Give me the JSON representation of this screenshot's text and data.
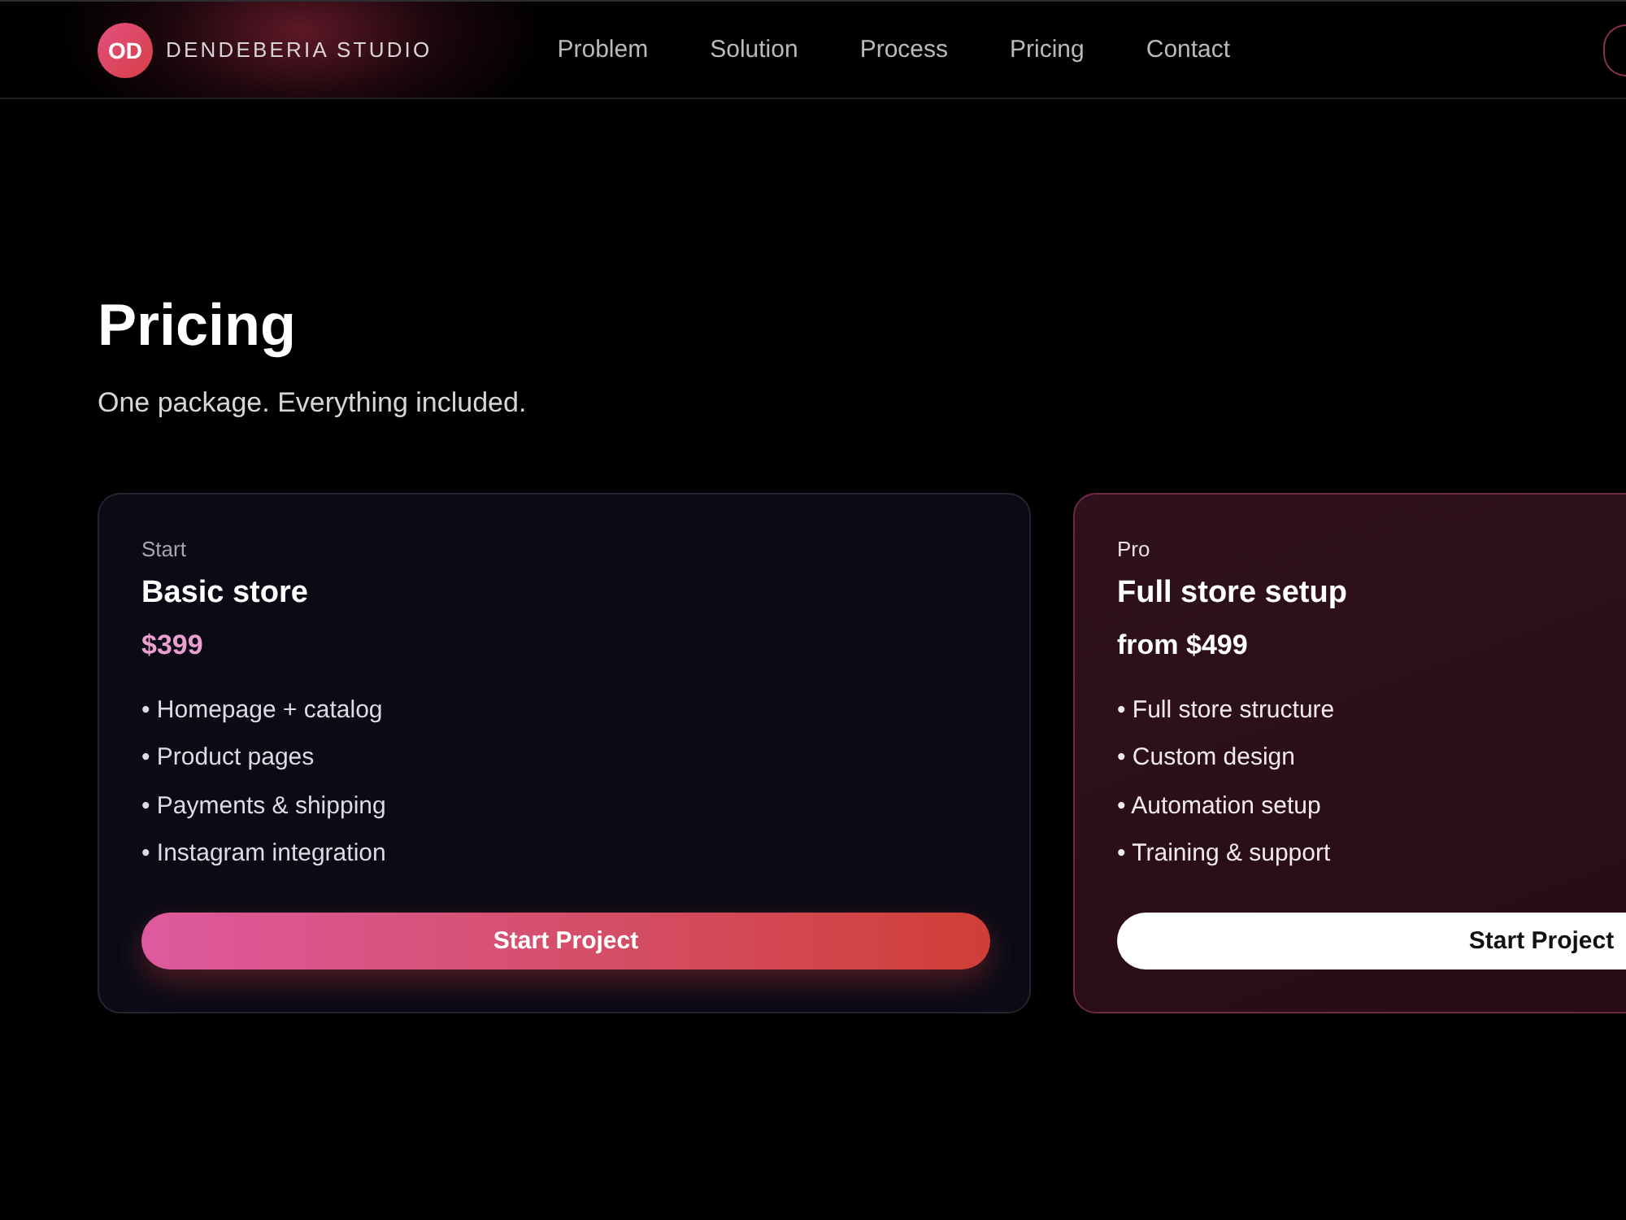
{
  "header": {
    "logo": "OD",
    "brand": "DENDEBERIA STUDIO",
    "nav": [
      "Problem",
      "Solution",
      "Process",
      "Pricing",
      "Contact"
    ]
  },
  "section": {
    "title": "Pricing",
    "subtitle": "One package. Everything included."
  },
  "plans": [
    {
      "tier": "Start",
      "name": "Basic store",
      "price": "$399",
      "features": [
        "• Homepage + catalog",
        "• Product pages",
        "• Payments & shipping",
        "• Instagram integration"
      ],
      "button": "Start Project",
      "highlighted": false
    },
    {
      "tier": "Pro",
      "name": "Full store setup",
      "price": "from $499",
      "features": [
        "• Full store structure",
        "• Custom design",
        "• Automation setup",
        "• Training & support"
      ],
      "button": "Start Project",
      "highlighted": true
    }
  ]
}
